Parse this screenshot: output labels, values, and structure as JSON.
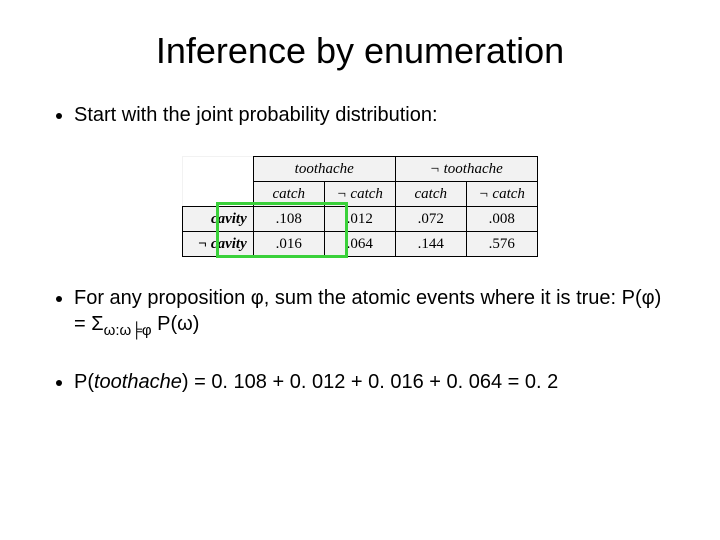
{
  "title": "Inference by enumeration",
  "bullets": {
    "b1": "Start with the joint probability distribution:",
    "b2_pre": "For any proposition φ, sum the atomic events where it is true: P(φ) = Σ",
    "b2_sub": "ω:ω╞φ",
    "b2_post": " P(ω)",
    "b3_pre": "P(",
    "b3_it": "toothache",
    "b3_post": ") = 0. 108 + 0. 012 + 0. 016 + 0. 064 = 0. 2"
  },
  "table": {
    "col_top": [
      "toothache",
      "¬ toothache"
    ],
    "col_sub": [
      "catch",
      "¬ catch",
      "catch",
      "¬ catch"
    ],
    "rows": [
      {
        "label": "cavity",
        "cells": [
          ".108",
          ".012",
          ".072",
          ".008"
        ]
      },
      {
        "label": "¬ cavity",
        "cells": [
          ".016",
          ".064",
          ".144",
          ".576"
        ]
      }
    ]
  },
  "chart_data": {
    "type": "table",
    "title": "Joint probability distribution",
    "row_labels": [
      "cavity",
      "¬cavity"
    ],
    "col_group_labels": [
      "toothache",
      "¬toothache"
    ],
    "col_sub_labels": [
      "catch",
      "¬catch",
      "catch",
      "¬catch"
    ],
    "values": [
      [
        0.108,
        0.012,
        0.072,
        0.008
      ],
      [
        0.016,
        0.064,
        0.144,
        0.576
      ]
    ],
    "highlighted_columns": [
      0,
      1
    ],
    "highlighted_sum_expression": "0.108 + 0.012 + 0.016 + 0.064 = 0.2"
  }
}
